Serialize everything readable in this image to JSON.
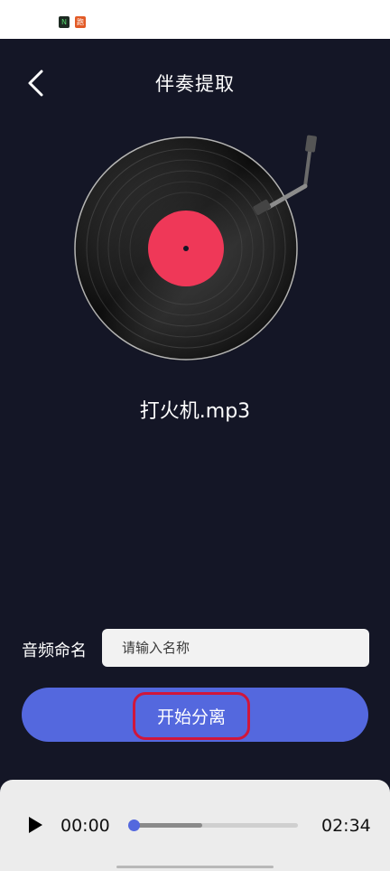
{
  "status_bar": {
    "icons": [
      {
        "name": "notes-app-icon",
        "glyph": "N",
        "color": "#1d2a22"
      },
      {
        "name": "reminder-app-icon",
        "glyph": "跑",
        "color": "#e25a26"
      }
    ]
  },
  "header": {
    "title": "伴奏提取",
    "back_icon": "chevron-left-icon"
  },
  "record": {
    "label_color": "#ef3858"
  },
  "file": {
    "name": "打火机.mp3"
  },
  "audio_name": {
    "label": "音频命名",
    "placeholder": "请输入名称",
    "value": ""
  },
  "actions": {
    "start_label": "开始分离",
    "accent": "#5468de",
    "highlight": "#d0163b"
  },
  "player": {
    "current_time": "00:00",
    "total_time": "02:34",
    "buffered_fraction": 0.42,
    "play_icon": "play-icon"
  }
}
